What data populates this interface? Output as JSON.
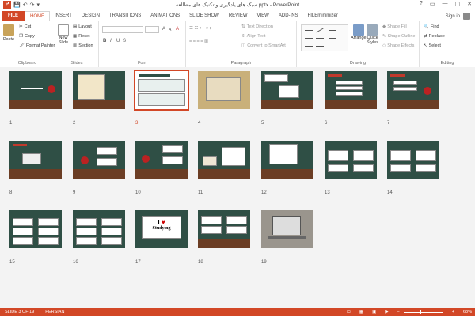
{
  "window": {
    "title": "سبک های یادگیری و تکنیک های مطالعه.pptx - PowerPoint",
    "app_logo": "P",
    "controls": [
      "?",
      "▭",
      "—",
      "▢",
      "✕"
    ]
  },
  "quick_access": [
    "💾",
    "↶",
    "↷",
    "▾"
  ],
  "tabs": [
    {
      "label": "FILE",
      "kind": "file"
    },
    {
      "label": "HOME",
      "kind": "active"
    },
    {
      "label": "INSERT"
    },
    {
      "label": "DESIGN"
    },
    {
      "label": "TRANSITIONS"
    },
    {
      "label": "ANIMATIONS"
    },
    {
      "label": "SLIDE SHOW"
    },
    {
      "label": "REVIEW"
    },
    {
      "label": "VIEW"
    },
    {
      "label": "ADD-INS"
    },
    {
      "label": "FILEminimizer"
    }
  ],
  "account": {
    "signin": "Sign in"
  },
  "ribbon": {
    "clipboard": {
      "label": "Clipboard",
      "paste": "Paste",
      "cut": "Cut",
      "copy": "Copy",
      "format_painter": "Format Painter"
    },
    "slides": {
      "label": "Slides",
      "new_slide": "New",
      "new_slide2": "Slide",
      "layout": "Layout",
      "reset": "Reset",
      "section": "Section"
    },
    "font": {
      "label": "Font",
      "bold": "B",
      "italic": "I",
      "underline": "U",
      "strike": "S",
      "grow": "A",
      "shrink": "A",
      "clear": "A"
    },
    "paragraph": {
      "label": "Paragraph",
      "text_direction": "Text Direction",
      "align_text": "Align Text",
      "smartart": "Convert to SmartArt"
    },
    "drawing": {
      "label": "Drawing",
      "arrange": "Arrange",
      "quick_styles": "Quick",
      "quick_styles2": "Styles",
      "shape_fill": "Shape Fill",
      "shape_outline": "Shape Outline",
      "shape_effects": "Shape Effects"
    },
    "editing": {
      "label": "Editing",
      "find": "Find",
      "replace": "Replace",
      "select": "Select"
    }
  },
  "slides": {
    "selected": 3,
    "studying_text": "Studying",
    "labels": [
      "1",
      "2",
      "3",
      "4",
      "5",
      "6",
      "7",
      "8",
      "9",
      "10",
      "11",
      "12",
      "13",
      "14",
      "15",
      "16",
      "17",
      "18",
      "19"
    ]
  },
  "status": {
    "slide": "SLIDE 3 OF 19",
    "language": "PERSIAN",
    "zoom": "68%",
    "zoom_minus": "−",
    "zoom_plus": "+"
  }
}
